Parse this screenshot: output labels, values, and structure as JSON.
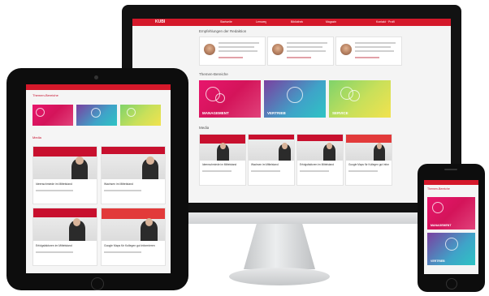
{
  "desktop": {
    "nav_logo": "KUBI",
    "nav_items": [
      "Startseite",
      "Lernweg",
      "Bibliothek",
      "Magazin"
    ],
    "nav_right": "Kontakt · Profil",
    "section_recommend": "Empfehlungen der Redaktion",
    "section_themes": "Themen-Bereiche",
    "section_media": "Media",
    "tiles": [
      {
        "label": "MANAGEMENT",
        "color": "#e0266e"
      },
      {
        "label": "VERTRIEB",
        "color": "#3fa3c8"
      },
      {
        "label": "SERVICE",
        "color": "#c9e05a"
      }
    ],
    "media_titles": [
      "Ideenschmiede im Mittelstand",
      "Wachsen im Mittelstand",
      "Erfolgsfaktoren im Mittelstand",
      "Google Maps für Kollegen gut informieren"
    ]
  },
  "tablet": {
    "section_themes": "Themen-Bereiche",
    "section_media": "Media",
    "media_titles": [
      "Ideenschmiede im Mittelstand",
      "Wachsen im Mittelstand",
      "Erfolgsfaktoren im Mittelstand",
      "Google Maps für Kollegen gut informieren"
    ]
  },
  "phone": {
    "section_themes": "Themen-Bereiche",
    "tiles": [
      {
        "label": "MANAGEMENT"
      },
      {
        "label": "VERTRIEB"
      }
    ]
  },
  "colors": {
    "brand_red": "#d4182a",
    "device_black": "#111111",
    "stand_silver": "#d6d8da"
  }
}
